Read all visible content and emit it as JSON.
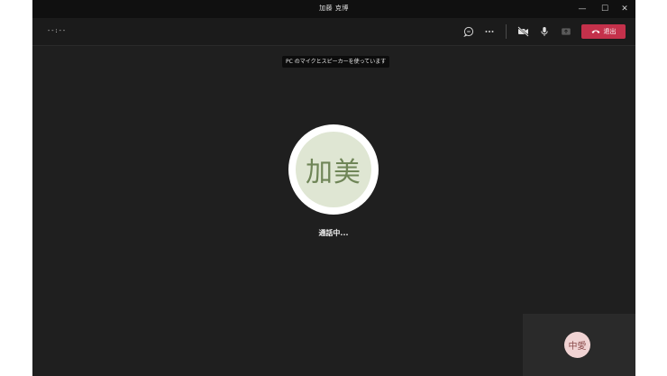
{
  "window": {
    "title": "加藤 克博",
    "controls": {
      "minimize": "—",
      "maximize": "☐",
      "close": "✕"
    }
  },
  "toolbar": {
    "timer": "--:--",
    "leave_label": "退出",
    "icons": [
      "chat-icon",
      "more-icon",
      "camera-off-icon",
      "mic-icon",
      "share-icon",
      "phone-hangup-icon"
    ]
  },
  "banner": {
    "text": "PC のマイクとスピーカーを使っています"
  },
  "callee": {
    "initials": "加美",
    "status": "通話中..."
  },
  "self": {
    "initials": "中愛"
  },
  "colors": {
    "window_bg": "#1f1f1f",
    "leave_button": "#c4314b",
    "callee_avatar_bg": "#dfe6d3",
    "callee_avatar_text": "#6f8557",
    "self_avatar_bg": "#f0d3d3"
  }
}
